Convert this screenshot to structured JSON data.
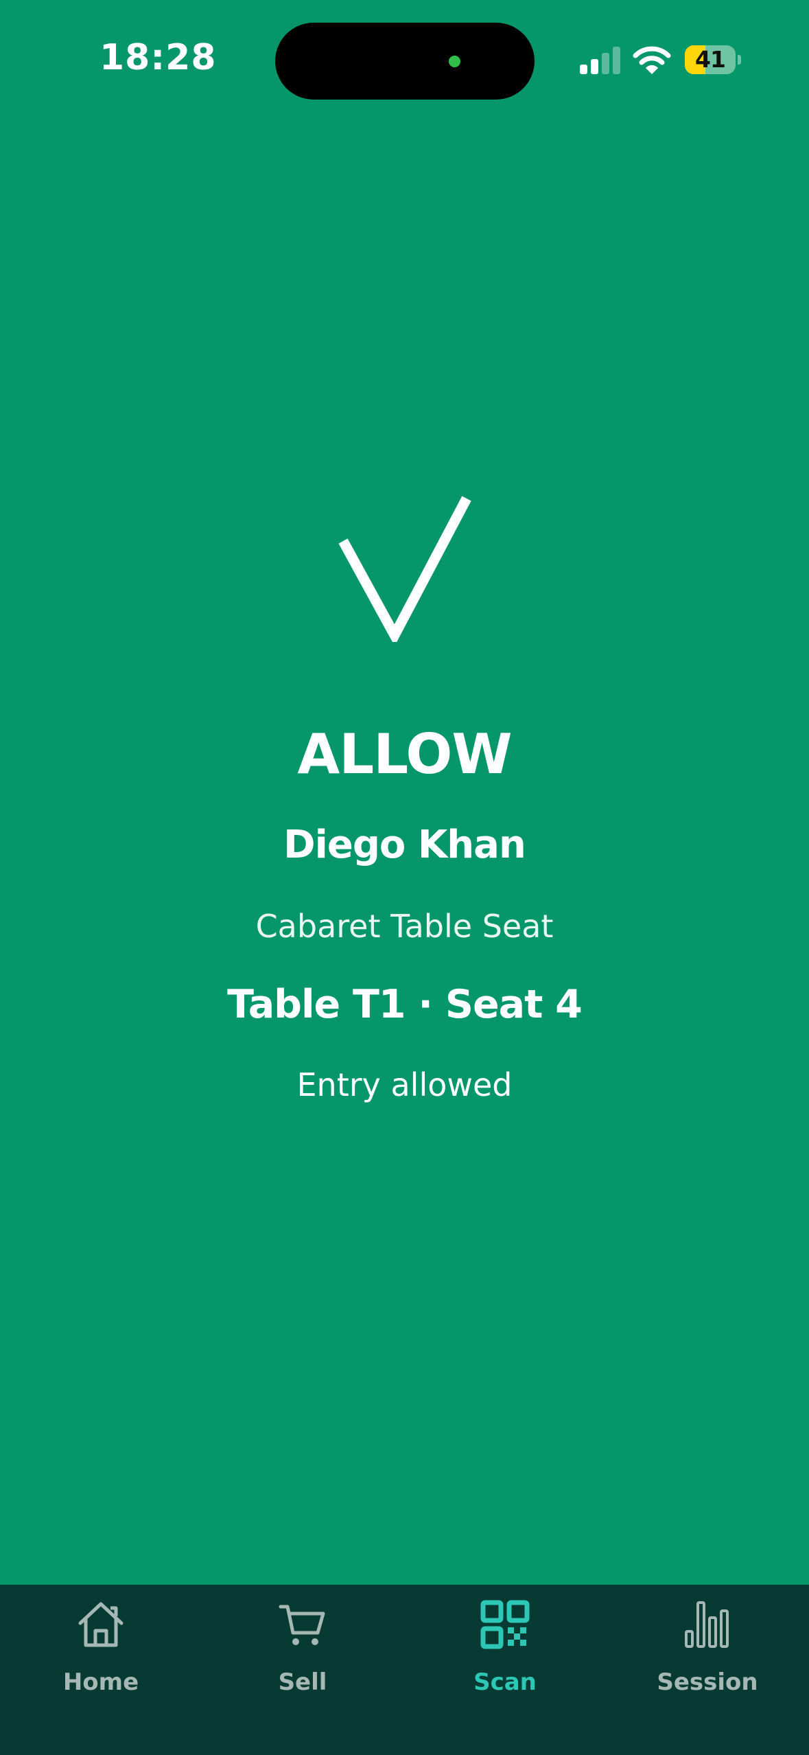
{
  "status_bar": {
    "time": "18:28",
    "battery_level": "41",
    "battery_fraction": 0.41,
    "battery_color": "#FFD60A",
    "signal_bars_active": 2,
    "signal_bars_total": 4
  },
  "result": {
    "icon": "check-icon",
    "title": "ALLOW",
    "attendee_name": "Diego Khan",
    "ticket_type": "Cabaret Table Seat",
    "seat": "Table T1 · Seat 4",
    "message": "Entry allowed",
    "background_color": "#05976A"
  },
  "tab_bar": {
    "background_color": "#073A33",
    "active_color": "#2CC7B5",
    "inactive_color": "#A6B8B3",
    "active_tab": "scan",
    "tabs": [
      {
        "id": "home",
        "label": "Home",
        "icon": "home-icon"
      },
      {
        "id": "sell",
        "label": "Sell",
        "icon": "cart-icon"
      },
      {
        "id": "scan",
        "label": "Scan",
        "icon": "qr-code-icon"
      },
      {
        "id": "session",
        "label": "Session",
        "icon": "bar-chart-icon"
      }
    ]
  }
}
